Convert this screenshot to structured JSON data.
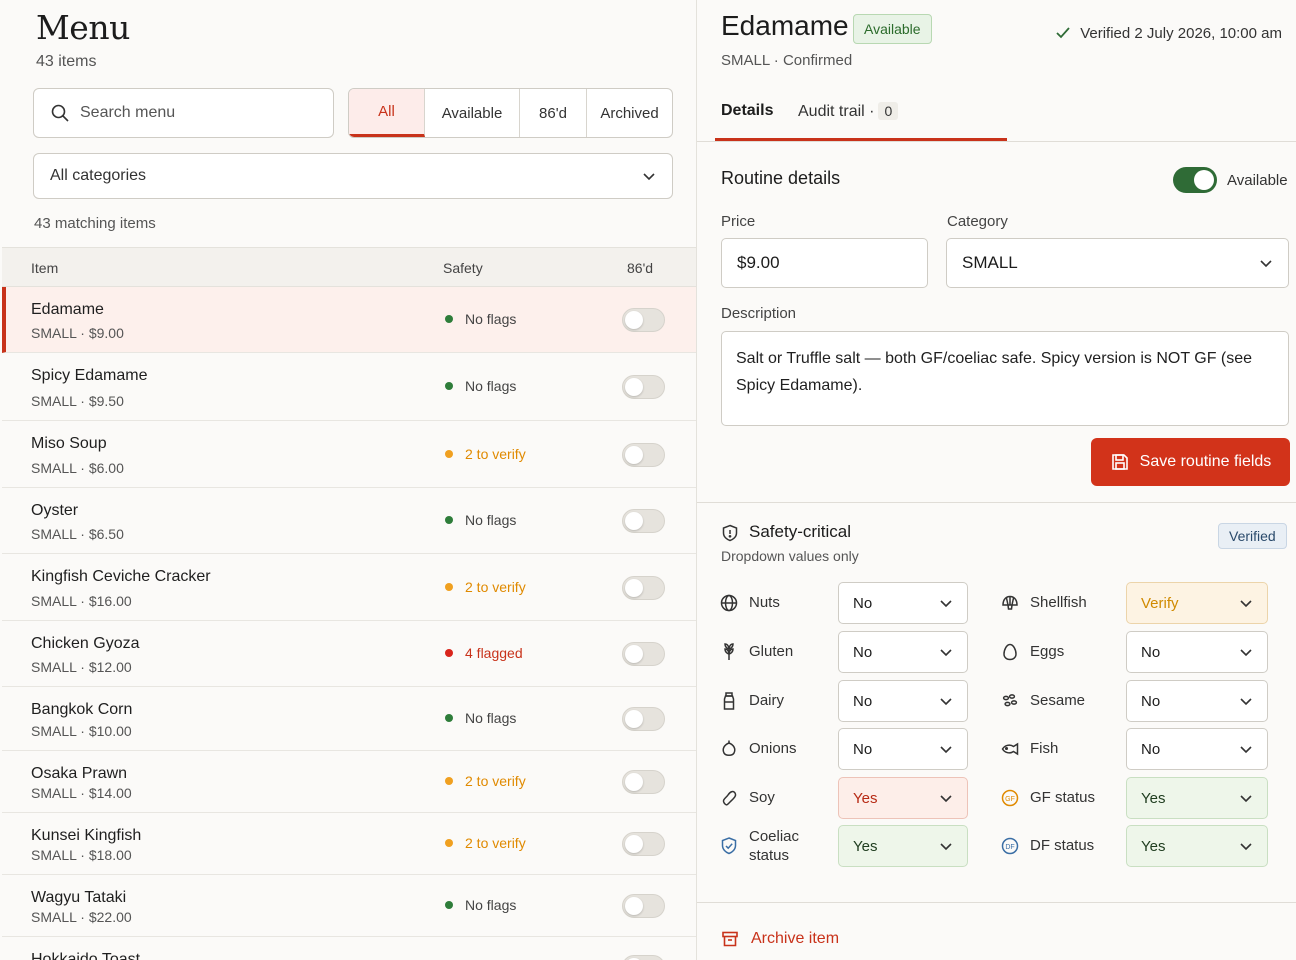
{
  "menu": {
    "title": "Menu",
    "count": "43 items",
    "search_placeholder": "Search menu",
    "filters": [
      "All",
      "Available",
      "86'd",
      "Archived"
    ],
    "category_select": "All categories",
    "matching": "43 matching items",
    "columns": {
      "item": "Item",
      "safety": "Safety",
      "eightysix": "86'd"
    },
    "rows": [
      {
        "name": "Edamame",
        "sub": "SMALL · $9.00",
        "safety": "No flags",
        "status": "none",
        "selected": true
      },
      {
        "name": "Spicy Edamame",
        "sub": "SMALL · $9.50",
        "safety": "No flags",
        "status": "none"
      },
      {
        "name": "Miso Soup",
        "sub": "SMALL · $6.00",
        "safety": "2 to verify",
        "status": "amber"
      },
      {
        "name": "Oyster",
        "sub": "SMALL · $6.50",
        "safety": "No flags",
        "status": "none"
      },
      {
        "name": "Kingfish Ceviche Cracker",
        "sub": "SMALL · $16.00",
        "safety": "2 to verify",
        "status": "amber"
      },
      {
        "name": "Chicken Gyoza",
        "sub": "SMALL · $12.00",
        "safety": "4 flagged",
        "status": "red"
      },
      {
        "name": "Bangkok Corn",
        "sub": "SMALL · $10.00",
        "safety": "No flags",
        "status": "none"
      },
      {
        "name": "Osaka Prawn",
        "sub": "SMALL · $14.00",
        "safety": "2 to verify",
        "status": "amber"
      },
      {
        "name": "Kunsei Kingfish",
        "sub": "SMALL · $18.00",
        "safety": "2 to verify",
        "status": "amber"
      },
      {
        "name": "Wagyu Tataki",
        "sub": "SMALL · $22.00",
        "safety": "No flags",
        "status": "none"
      },
      {
        "name": "Hokkaido Toast",
        "sub": "",
        "safety": "",
        "status": ""
      }
    ]
  },
  "detail": {
    "title": "Edamame",
    "badge": "Available",
    "verified": "Verified 2 July 2026, 10:00 am",
    "subtitle": "SMALL · Confirmed",
    "tabs": {
      "details": "Details",
      "audit": "Audit trail ·",
      "audit_count": "0"
    },
    "routine": {
      "title": "Routine details",
      "available_label": "Available",
      "price_label": "Price",
      "price_value": "$9.00",
      "category_label": "Category",
      "category_value": "SMALL",
      "description_label": "Description",
      "description": "Salt or Truffle salt — both GF/coeliac safe. Spicy version is NOT GF (see Spicy Edamame).",
      "save_label": "Save routine fields"
    },
    "safety": {
      "title": "Safety-critical",
      "subtitle": "Dropdown values only",
      "badge": "Verified",
      "left": [
        {
          "icon": "globe-icon",
          "label": "Nuts",
          "value": "No",
          "tone": "plain"
        },
        {
          "icon": "wheat-icon",
          "label": "Gluten",
          "value": "No",
          "tone": "plain"
        },
        {
          "icon": "milk-bottle-icon",
          "label": "Dairy",
          "value": "No",
          "tone": "plain"
        },
        {
          "icon": "onion-icon",
          "label": "Onions",
          "value": "No",
          "tone": "plain"
        },
        {
          "icon": "bean-icon",
          "label": "Soy",
          "value": "Yes",
          "tone": "red"
        },
        {
          "icon": "shield-check-icon",
          "label": "Coeliac status",
          "value": "Yes",
          "tone": "green"
        }
      ],
      "right": [
        {
          "icon": "shell-icon",
          "label": "Shellfish",
          "value": "Verify",
          "tone": "amber"
        },
        {
          "icon": "egg-icon",
          "label": "Eggs",
          "value": "No",
          "tone": "plain"
        },
        {
          "icon": "seeds-icon",
          "label": "Sesame",
          "value": "No",
          "tone": "plain"
        },
        {
          "icon": "fish-icon",
          "label": "Fish",
          "value": "No",
          "tone": "plain"
        },
        {
          "icon": "gf-badge-icon",
          "label": "GF status",
          "value": "Yes",
          "tone": "green"
        },
        {
          "icon": "df-badge-icon",
          "label": "DF status",
          "value": "Yes",
          "tone": "green"
        }
      ]
    },
    "archive_label": "Archive item"
  },
  "colors": {
    "accent": "#c8321a",
    "success": "#2f6b36",
    "warning": "#e08a00"
  }
}
